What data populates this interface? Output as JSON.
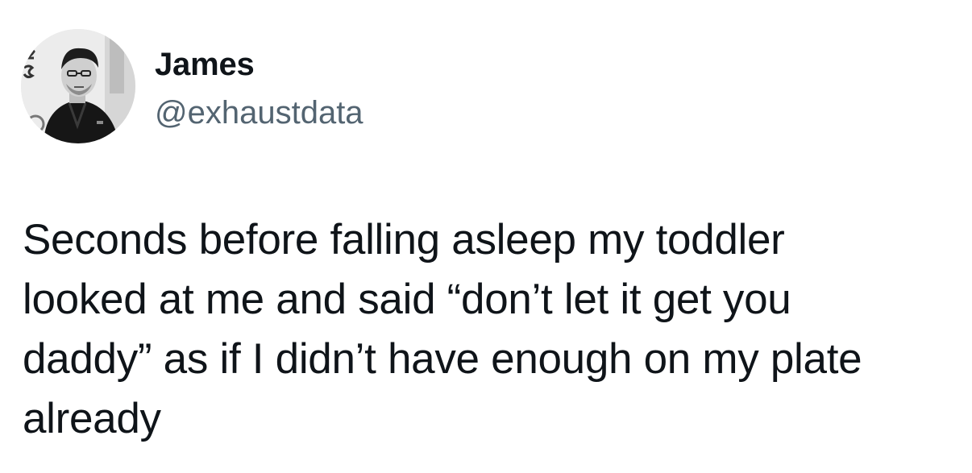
{
  "tweet": {
    "author": {
      "display_name": "James",
      "handle": "@exhaustdata",
      "avatar_icon": "profile-photo-avatar"
    },
    "text": "Seconds before falling asleep my toddler\nlooked at me and said “don’t let it get you\ndaddy” as if I didn’t have enough on my plate\nalready"
  },
  "colors": {
    "background": "#ffffff",
    "name_text": "#0f1419",
    "handle_text": "#536471",
    "body_text": "#0f1419"
  }
}
